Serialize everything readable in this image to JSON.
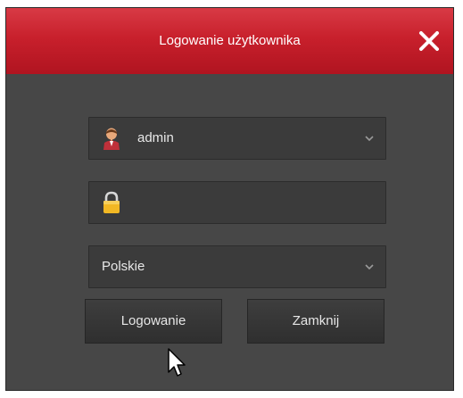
{
  "dialog": {
    "title": "Logowanie użytkownika",
    "close_icon": "close-icon"
  },
  "username": {
    "value": "admin",
    "icon": "user-icon",
    "dropdown_icon": "chevron-down-icon"
  },
  "password": {
    "value": "",
    "icon": "lock-icon"
  },
  "language": {
    "value": "Polskie",
    "dropdown_icon": "chevron-down-icon"
  },
  "buttons": {
    "login_label": "Logowanie",
    "close_label": "Zamknij"
  },
  "colors": {
    "titlebar": "#c8202c",
    "panel": "#474747",
    "field": "#3b3b3b",
    "text": "#e8e8e8"
  }
}
